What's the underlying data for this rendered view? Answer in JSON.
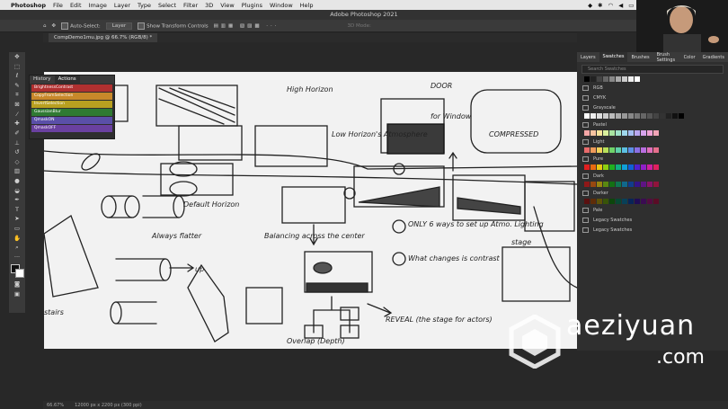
{
  "menubar": {
    "apple": "",
    "items": [
      "Photoshop",
      "File",
      "Edit",
      "Image",
      "Layer",
      "Type",
      "Select",
      "Filter",
      "3D",
      "View",
      "Plugins",
      "Window",
      "Help"
    ]
  },
  "window_title": "Adobe Photoshop 2021",
  "options_bar": {
    "auto_select_label": "Auto-Select:",
    "auto_select_value": "Layer",
    "show_transform_label": "Show Transform Controls",
    "mode_label": "3D Mode:"
  },
  "document_tab": "CompDemo1mu.jpg @ 66.7% (RGB/8) *",
  "actions_panel": {
    "tabs": [
      "History",
      "Actions"
    ],
    "actions": [
      {
        "label": "BrightnessContrast",
        "color": "#b03030"
      },
      {
        "label": "CopyFromSelection",
        "color": "#c8882a"
      },
      {
        "label": "InvertSelection",
        "color": "#b8a020"
      },
      {
        "label": "GaussianBlur",
        "color": "#2f7a33"
      },
      {
        "label": "QmaskON",
        "color": "#5a4fa8"
      },
      {
        "label": "QmaskOFF",
        "color": "#6a40a0"
      }
    ]
  },
  "right_panel": {
    "tabs": [
      "Layers",
      "Swatches",
      "Brushes",
      "Brush Settings",
      "Color",
      "Gradients"
    ],
    "active_tab": "Swatches",
    "search_placeholder": "Search Swatches",
    "groups": [
      "RGB",
      "CMYK",
      "Grayscale",
      "Pastel",
      "Light",
      "Pure",
      "Dark",
      "Darker",
      "Pale",
      "Legacy Swatches",
      "Legacy Swatches"
    ]
  },
  "sketch_annotations": {
    "high_horizon": "High Horizon",
    "low_horizon": "Low Horizon's Atmosphere",
    "door": "DOOR",
    "window": "for Window",
    "compressed": "COMPRESSED",
    "default_horizon": "Default Horizon",
    "balancing": "Balancing across the center",
    "only6": "ONLY 6 ways to set up Atmo. Lighting",
    "what_changes": "What changes is contrast",
    "reveal": "REVEAL (the stage for actors)",
    "overlap": "Overlap (Depth)",
    "always_flatter": "Always flatter",
    "up": "up",
    "stage": "stage",
    "stairs": "stairs"
  },
  "statusbar": {
    "zoom": "66.67%",
    "doc_size": "12000 px x 2200 px (300 ppi)"
  },
  "watermark": {
    "brand": "aeziyuan",
    "domain": ".com"
  }
}
